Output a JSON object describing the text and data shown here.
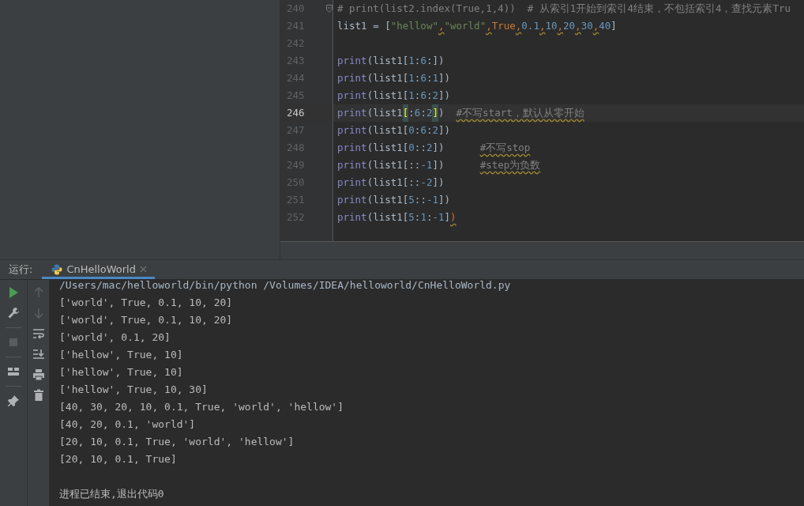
{
  "editor": {
    "lines": [
      {
        "number": "240",
        "current": false,
        "fold": true,
        "tokens": [
          {
            "text": "# print(list2.index(True,1,4))  # 从索引1开始到索引4结束，不包括索引4，查找元素Tru",
            "kind": "comment"
          }
        ]
      },
      {
        "number": "241",
        "current": false,
        "tokens": [
          {
            "text": "list1 = [",
            "kind": "plain"
          },
          {
            "text": "\"hellow\"",
            "kind": "string"
          },
          {
            "text": ",",
            "kind": "warn-comma"
          },
          {
            "text": "\"world\"",
            "kind": "string"
          },
          {
            "text": ",",
            "kind": "warn-comma"
          },
          {
            "text": "True",
            "kind": "bool"
          },
          {
            "text": ",",
            "kind": "warn-comma"
          },
          {
            "text": "0.1",
            "kind": "number"
          },
          {
            "text": ",",
            "kind": "warn-comma"
          },
          {
            "text": "10",
            "kind": "number"
          },
          {
            "text": ",",
            "kind": "warn-comma"
          },
          {
            "text": "20",
            "kind": "number"
          },
          {
            "text": ",",
            "kind": "warn-comma"
          },
          {
            "text": "30",
            "kind": "number"
          },
          {
            "text": ",",
            "kind": "warn-comma"
          },
          {
            "text": "40",
            "kind": "number"
          },
          {
            "text": "]",
            "kind": "plain"
          }
        ]
      },
      {
        "number": "242",
        "current": false
      },
      {
        "number": "243",
        "current": false,
        "tokens": [
          {
            "text": "print",
            "kind": "builtin"
          },
          {
            "text": "(list1[",
            "kind": "plain"
          },
          {
            "text": "1",
            "kind": "number"
          },
          {
            "text": ":",
            "kind": "plain"
          },
          {
            "text": "6",
            "kind": "number"
          },
          {
            "text": ":])",
            "kind": "plain"
          }
        ]
      },
      {
        "number": "244",
        "current": false,
        "tokens": [
          {
            "text": "print",
            "kind": "builtin"
          },
          {
            "text": "(list1[",
            "kind": "plain"
          },
          {
            "text": "1",
            "kind": "number"
          },
          {
            "text": ":",
            "kind": "plain"
          },
          {
            "text": "6",
            "kind": "number"
          },
          {
            "text": ":",
            "kind": "plain"
          },
          {
            "text": "1",
            "kind": "number"
          },
          {
            "text": "])",
            "kind": "plain"
          }
        ]
      },
      {
        "number": "245",
        "current": false,
        "tokens": [
          {
            "text": "print",
            "kind": "builtin"
          },
          {
            "text": "(list1[",
            "kind": "plain"
          },
          {
            "text": "1",
            "kind": "number"
          },
          {
            "text": ":",
            "kind": "plain"
          },
          {
            "text": "6",
            "kind": "number"
          },
          {
            "text": ":",
            "kind": "plain"
          },
          {
            "text": "2",
            "kind": "number"
          },
          {
            "text": "])",
            "kind": "plain"
          }
        ]
      },
      {
        "number": "246",
        "current": true,
        "tokens": [
          {
            "text": "print",
            "kind": "builtin"
          },
          {
            "text": "(list1",
            "kind": "plain"
          },
          {
            "text": "[",
            "kind": "bracket-match"
          },
          {
            "text": ":",
            "kind": "plain"
          },
          {
            "text": "6",
            "kind": "number"
          },
          {
            "text": ":",
            "kind": "plain"
          },
          {
            "text": "2",
            "kind": "number"
          },
          {
            "text": "]",
            "kind": "bracket-match"
          },
          {
            "text": ")  ",
            "kind": "plain"
          },
          {
            "text": "#不写start，默认从零开始",
            "kind": "warn-comment"
          }
        ]
      },
      {
        "number": "247",
        "current": false,
        "tokens": [
          {
            "text": "print",
            "kind": "builtin"
          },
          {
            "text": "(list1[",
            "kind": "plain"
          },
          {
            "text": "0",
            "kind": "number"
          },
          {
            "text": ":",
            "kind": "plain"
          },
          {
            "text": "6",
            "kind": "number"
          },
          {
            "text": ":",
            "kind": "plain"
          },
          {
            "text": "2",
            "kind": "number"
          },
          {
            "text": "])",
            "kind": "plain"
          }
        ]
      },
      {
        "number": "248",
        "current": false,
        "tokens": [
          {
            "text": "print",
            "kind": "builtin"
          },
          {
            "text": "(list1[",
            "kind": "plain"
          },
          {
            "text": "0",
            "kind": "number"
          },
          {
            "text": "::",
            "kind": "plain"
          },
          {
            "text": "2",
            "kind": "number"
          },
          {
            "text": "])      ",
            "kind": "plain"
          },
          {
            "text": "#不写stop",
            "kind": "warn-comment"
          }
        ]
      },
      {
        "number": "249",
        "current": false,
        "tokens": [
          {
            "text": "print",
            "kind": "builtin"
          },
          {
            "text": "(list1[::",
            "kind": "plain"
          },
          {
            "text": "-1",
            "kind": "number"
          },
          {
            "text": "])      ",
            "kind": "plain"
          },
          {
            "text": "#step为负数",
            "kind": "warn-comment"
          }
        ]
      },
      {
        "number": "250",
        "current": false,
        "tokens": [
          {
            "text": "print",
            "kind": "builtin"
          },
          {
            "text": "(list1[::",
            "kind": "plain"
          },
          {
            "text": "-2",
            "kind": "number"
          },
          {
            "text": "])",
            "kind": "plain"
          }
        ]
      },
      {
        "number": "251",
        "current": false,
        "tokens": [
          {
            "text": "print",
            "kind": "builtin"
          },
          {
            "text": "(list1[",
            "kind": "plain"
          },
          {
            "text": "5",
            "kind": "number"
          },
          {
            "text": "::",
            "kind": "plain"
          },
          {
            "text": "-1",
            "kind": "number"
          },
          {
            "text": "])",
            "kind": "plain"
          }
        ]
      },
      {
        "number": "252",
        "current": false,
        "tokens": [
          {
            "text": "print",
            "kind": "builtin"
          },
          {
            "text": "(list1[",
            "kind": "plain"
          },
          {
            "text": "5",
            "kind": "number"
          },
          {
            "text": ":",
            "kind": "plain"
          },
          {
            "text": "1",
            "kind": "number"
          },
          {
            "text": ":",
            "kind": "plain"
          },
          {
            "text": "-1",
            "kind": "number"
          },
          {
            "text": "]",
            "kind": "plain"
          },
          {
            "text": ")",
            "kind": "warn-comma"
          }
        ]
      }
    ]
  },
  "run_panel": {
    "label": "运行:",
    "tabs": [
      {
        "label": "CnHelloWorld",
        "selected": true
      }
    ],
    "toolbar": [
      {
        "kind": "run",
        "disabled": false
      },
      {
        "kind": "wrench",
        "disabled": false
      },
      {
        "kind": "stop",
        "disabled": true
      },
      {
        "kind": "layout",
        "disabled": false
      },
      {
        "kind": "pin",
        "disabled": false
      }
    ],
    "toolbar_2": [
      {
        "kind": "up",
        "disabled": true
      },
      {
        "kind": "down",
        "disabled": true
      },
      {
        "kind": "wrap",
        "disabled": false
      },
      {
        "kind": "scroll-end",
        "disabled": false
      },
      {
        "kind": "print",
        "disabled": false
      },
      {
        "kind": "trash",
        "disabled": false
      }
    ],
    "console": [
      {
        "kind": "command",
        "text": "/Users/mac/helloworld/bin/python /Volumes/IDEA/helloworld/CnHelloWorld.py"
      },
      {
        "kind": "output",
        "text": "['world', True, 0.1, 10, 20]"
      },
      {
        "kind": "output",
        "text": "['world', True, 0.1, 10, 20]"
      },
      {
        "kind": "output",
        "text": "['world', 0.1, 20]"
      },
      {
        "kind": "output",
        "text": "['hellow', True, 10]"
      },
      {
        "kind": "output",
        "text": "['hellow', True, 10]"
      },
      {
        "kind": "output",
        "text": "['hellow', True, 10, 30]"
      },
      {
        "kind": "output",
        "text": "[40, 30, 20, 10, 0.1, True, 'world', 'hellow']"
      },
      {
        "kind": "output",
        "text": "[40, 20, 0.1, 'world']"
      },
      {
        "kind": "output",
        "text": "[20, 10, 0.1, True, 'world', 'hellow']"
      },
      {
        "kind": "output",
        "text": "[20, 10, 0.1, True]"
      },
      {
        "kind": "blank"
      },
      {
        "kind": "output",
        "text": "进程已结束,退出代码0"
      }
    ]
  }
}
